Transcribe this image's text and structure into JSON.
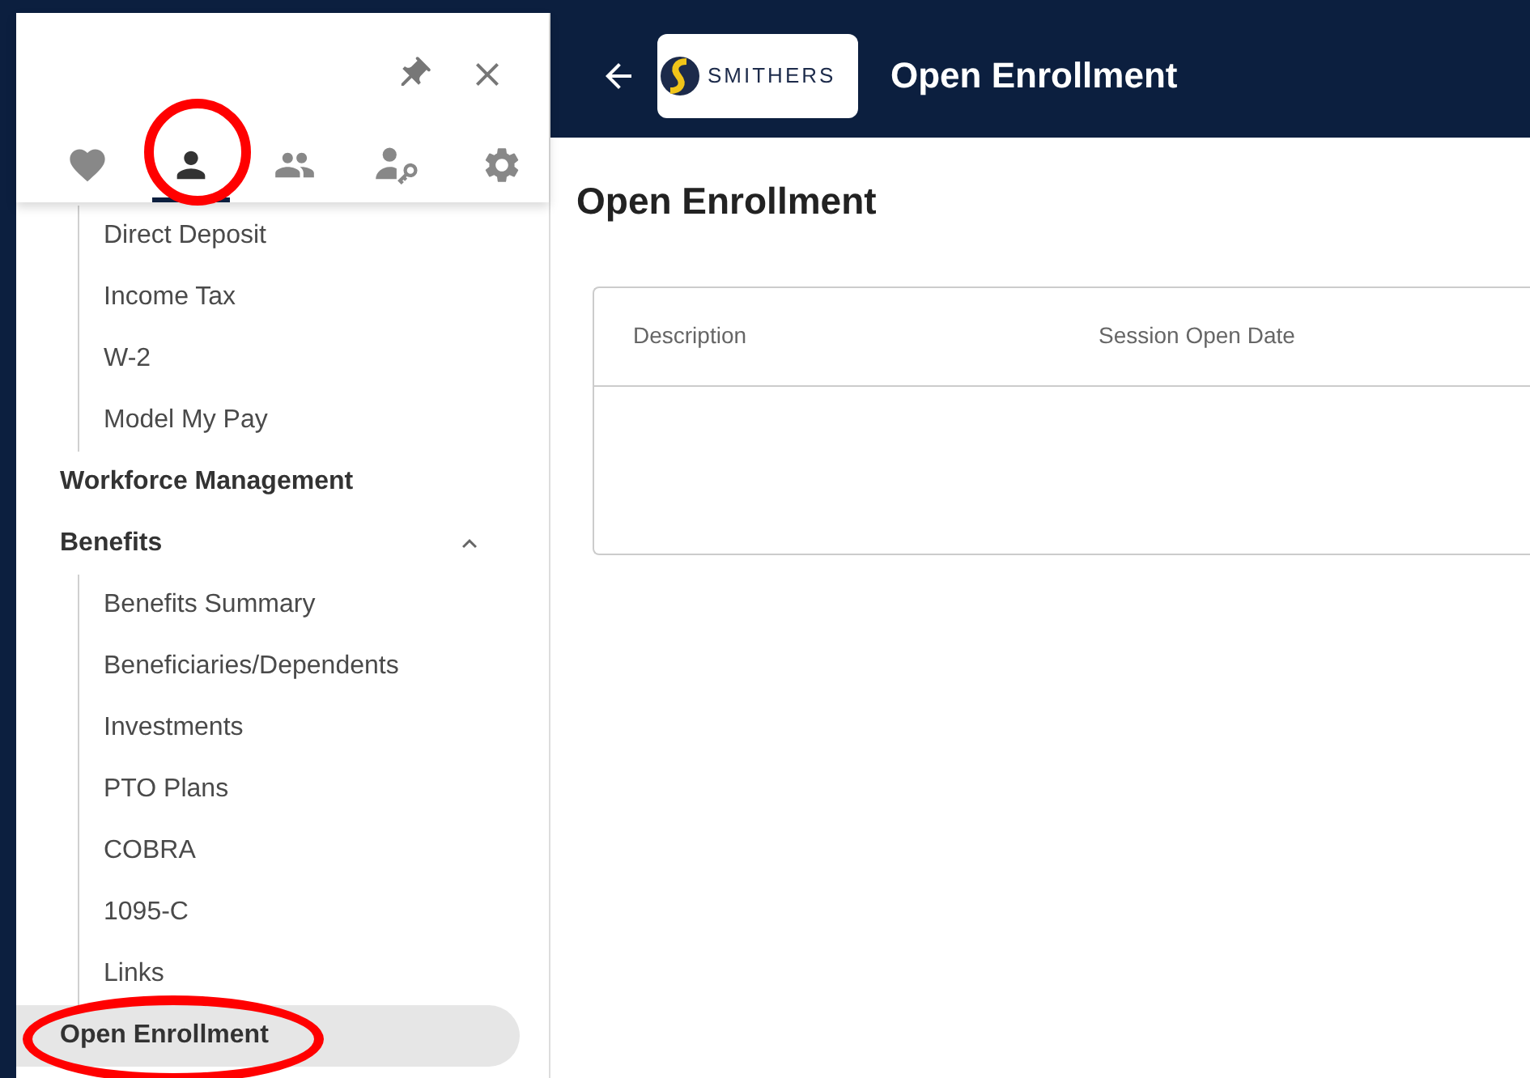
{
  "sidebar": {
    "tabs": [
      {
        "kind": "heart",
        "selected": false,
        "highlighted": false
      },
      {
        "kind": "person",
        "selected": true,
        "highlighted": true
      },
      {
        "kind": "people",
        "selected": false,
        "highlighted": false
      },
      {
        "kind": "person-key",
        "selected": false,
        "highlighted": false
      },
      {
        "kind": "gear",
        "selected": false,
        "highlighted": false
      }
    ],
    "items": [
      {
        "kind": "sub",
        "label": "Direct Deposit",
        "selected": false,
        "highlighted": false
      },
      {
        "kind": "sub",
        "label": "Income Tax",
        "selected": false,
        "highlighted": false
      },
      {
        "kind": "sub",
        "label": "W-2",
        "selected": false,
        "highlighted": false
      },
      {
        "kind": "sub",
        "label": "Model My Pay",
        "selected": false,
        "highlighted": false
      },
      {
        "kind": "section",
        "label": "Workforce Management",
        "selected": false,
        "highlighted": false
      },
      {
        "kind": "section",
        "label": "Benefits",
        "selected": false,
        "highlighted": false,
        "expanded": true,
        "children": [
          {
            "kind": "sub",
            "label": "Benefits Summary",
            "selected": false,
            "highlighted": false
          },
          {
            "kind": "sub",
            "label": "Beneficiaries/Dependents",
            "selected": false,
            "highlighted": false
          },
          {
            "kind": "sub",
            "label": "Investments",
            "selected": false,
            "highlighted": false
          },
          {
            "kind": "sub",
            "label": "PTO Plans",
            "selected": false,
            "highlighted": false
          },
          {
            "kind": "sub",
            "label": "COBRA",
            "selected": false,
            "highlighted": false
          },
          {
            "kind": "sub",
            "label": "1095-C",
            "selected": false,
            "highlighted": false
          },
          {
            "kind": "sub",
            "label": "Links",
            "selected": false,
            "highlighted": false
          }
        ]
      },
      {
        "kind": "section",
        "label": "Open Enrollment",
        "selected": true,
        "highlighted": true
      }
    ]
  },
  "header": {
    "logo_text": "SMITHERS",
    "title": "Open Enrollment"
  },
  "page": {
    "heading": "Open Enrollment",
    "table": {
      "columns": [
        "Description",
        "Session Open Date"
      ]
    }
  }
}
